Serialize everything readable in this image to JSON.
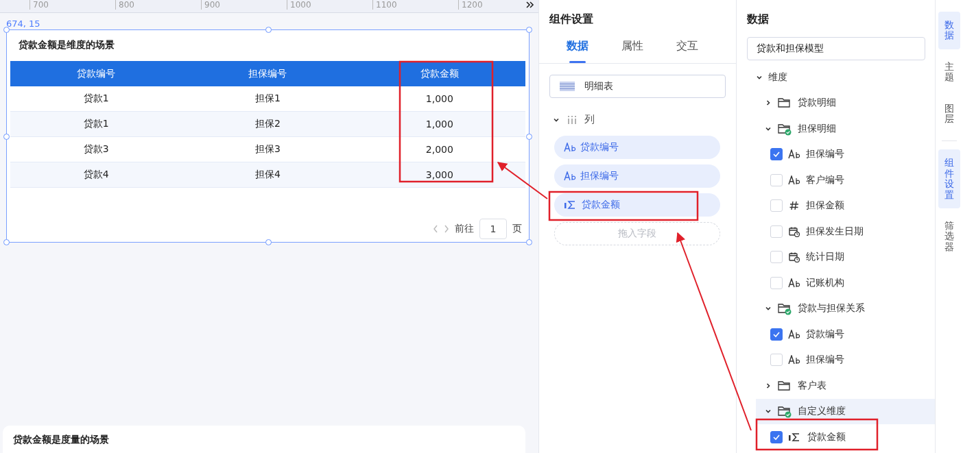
{
  "ruler": {
    "ticks": [
      "700",
      "800",
      "900",
      "1000",
      "1100",
      "1200"
    ]
  },
  "canvas": {
    "coordinates": "674, 15",
    "cards": [
      {
        "title": "贷款金额是维度的场景",
        "selected": true,
        "table": {
          "columns": [
            "贷款编号",
            "担保编号",
            "贷款金额"
          ],
          "rows": [
            [
              "贷款1",
              "担保1",
              "1,000"
            ],
            [
              "贷款1",
              "担保2",
              "1,000"
            ],
            [
              "贷款3",
              "担保3",
              "2,000"
            ],
            [
              "贷款4",
              "担保4",
              "3,000"
            ]
          ]
        },
        "pager": {
          "goto_label": "前往",
          "page": "1",
          "page_label": "页"
        }
      },
      {
        "title": "贷款金额是度量的场景",
        "selected": false
      }
    ]
  },
  "settings": {
    "title": "组件设置",
    "tabs": [
      {
        "label": "数据",
        "selected": true
      },
      {
        "label": "属性",
        "selected": false
      },
      {
        "label": "交互",
        "selected": false
      }
    ],
    "chart_type": "明细表",
    "section": {
      "label": "列",
      "expanded": true
    },
    "columns": [
      {
        "label": "贷款编号",
        "kind": "text"
      },
      {
        "label": "担保编号",
        "kind": "text"
      },
      {
        "label": "贷款金额",
        "kind": "measure"
      }
    ],
    "drop_placeholder": "拖入字段"
  },
  "data_panel": {
    "title": "数据",
    "model": "贷款和担保模型",
    "tree": [
      {
        "label": "维度",
        "kind": "group",
        "expanded": true,
        "selected": false,
        "children": [
          {
            "label": "贷款明细",
            "kind": "folder",
            "expanded": false,
            "linked": false,
            "selected": false
          },
          {
            "label": "担保明细",
            "kind": "folder",
            "expanded": true,
            "linked": true,
            "selected": false,
            "children": [
              {
                "label": "担保编号",
                "kind": "text",
                "checked": true
              },
              {
                "label": "客户编号",
                "kind": "text",
                "checked": false
              },
              {
                "label": "担保金额",
                "kind": "number",
                "checked": false
              },
              {
                "label": "担保发生日期",
                "kind": "date",
                "checked": false
              },
              {
                "label": "统计日期",
                "kind": "date",
                "checked": false
              },
              {
                "label": "记账机构",
                "kind": "text",
                "checked": false
              }
            ]
          },
          {
            "label": "贷款与担保关系",
            "kind": "folder",
            "expanded": true,
            "linked": true,
            "selected": false,
            "children": [
              {
                "label": "贷款编号",
                "kind": "text",
                "checked": true
              },
              {
                "label": "担保编号",
                "kind": "text",
                "checked": false
              }
            ]
          },
          {
            "label": "客户表",
            "kind": "folder",
            "expanded": false,
            "linked": false,
            "selected": false
          },
          {
            "label": "自定义维度",
            "kind": "folder",
            "expanded": true,
            "linked": true,
            "selected": true,
            "children": [
              {
                "label": "贷款金额",
                "kind": "measure",
                "checked": true
              }
            ]
          }
        ]
      }
    ]
  },
  "side_tabs": [
    {
      "label": "数据",
      "selected": true,
      "kind": "tab"
    },
    {
      "label": "主题",
      "selected": false,
      "kind": "tab"
    },
    {
      "label": "图层",
      "selected": false,
      "kind": "tab"
    },
    {
      "kind": "divider"
    },
    {
      "label": "组件设置",
      "selected": true,
      "kind": "tab"
    },
    {
      "label": "筛选器",
      "selected": false,
      "kind": "tab"
    }
  ]
}
